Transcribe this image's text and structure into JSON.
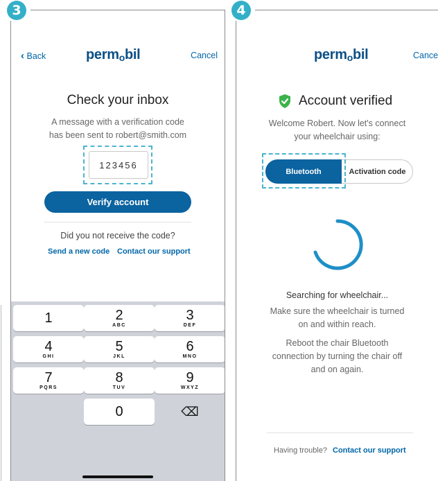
{
  "steps": {
    "left": "3",
    "right": "4"
  },
  "left": {
    "nav": {
      "back": "Back",
      "back_chevron": "‹",
      "logo_main": "perm",
      "logo_sub": "o",
      "logo_end": "bil",
      "cancel": "Cancel"
    },
    "title": "Check your inbox",
    "message_line1": "A message with a verification code",
    "message_line2": "has been sent to robert@smith.com",
    "code_value": "123456",
    "verify_button": "Verify account",
    "not_received": "Did you not receive the code?",
    "send_new_code": "Send a new code",
    "contact_support": "Contact our support",
    "keypad": [
      {
        "num": "1",
        "letters": ""
      },
      {
        "num": "2",
        "letters": "ABC"
      },
      {
        "num": "3",
        "letters": "DEF"
      },
      {
        "num": "4",
        "letters": "GHI"
      },
      {
        "num": "5",
        "letters": "JKL"
      },
      {
        "num": "6",
        "letters": "MNO"
      },
      {
        "num": "7",
        "letters": "PQRS"
      },
      {
        "num": "8",
        "letters": "TUV"
      },
      {
        "num": "9",
        "letters": "WXYZ"
      },
      {
        "num": "0",
        "letters": ""
      }
    ]
  },
  "right": {
    "nav": {
      "logo_main": "perm",
      "logo_sub": "o",
      "logo_end": "bil",
      "cancel": "Cance"
    },
    "title": "Account verified",
    "welcome_line1": "Welcome Robert. Now let's connect",
    "welcome_line2": "your wheelchair using:",
    "toggle": {
      "selected": "Bluetooth",
      "other": "Activation code"
    },
    "searching": "Searching for wheelchair...",
    "hint1_line1": "Make sure the wheelchair is turned",
    "hint1_line2": "on and within reach.",
    "hint2_line1": "Reboot the chair Bluetooth",
    "hint2_line2": "connection by turning the chair off",
    "hint2_line3": "and on again.",
    "trouble": "Having trouble?",
    "contact_support": "Contact our support"
  },
  "colors": {
    "accent": "#0066a8",
    "button": "#0b63a0",
    "highlight": "#4bb4d0",
    "success": "#3bb34a"
  },
  "icons": {
    "backspace": "⌫"
  }
}
